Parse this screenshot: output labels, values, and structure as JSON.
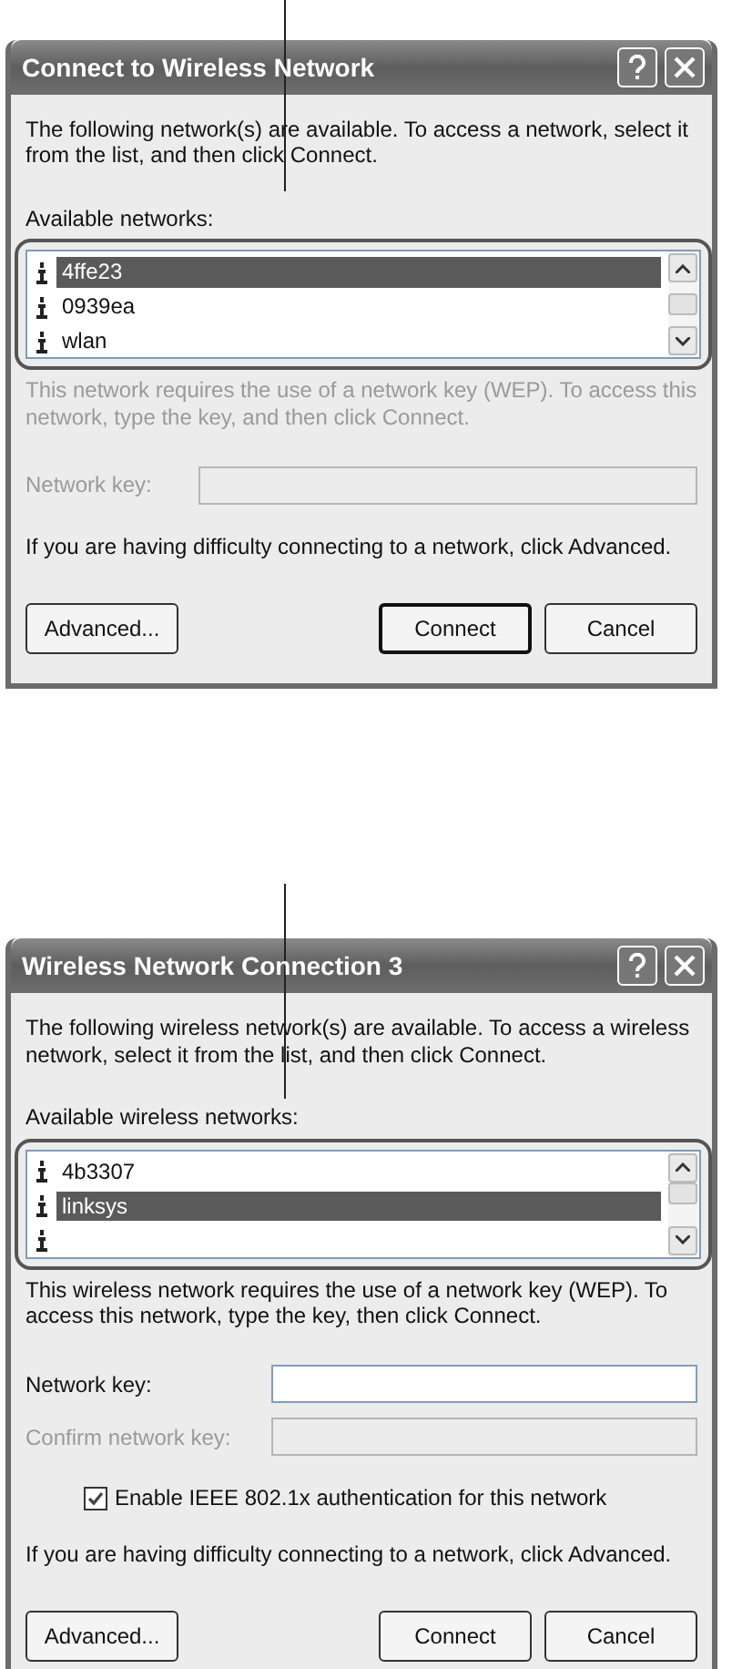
{
  "dialogs": [
    {
      "title": "Connect to Wireless Network",
      "intro": "The following network(s) are available. To access a network, select it from the list, and then click Connect.",
      "list_label": "Available networks:",
      "networks": [
        {
          "name": "4ffe23",
          "selected": true
        },
        {
          "name": "0939ea",
          "selected": false
        },
        {
          "name": "wlan",
          "selected": false
        }
      ],
      "key_note": {
        "text": "This network requires the use of a network key (WEP). To access this network, type the key, and then click Connect.",
        "disabled": true
      },
      "fields": [
        {
          "label": "Network key:",
          "disabled": true
        }
      ],
      "advice": "If you are having difficulty connecting to a network, click Advanced.",
      "buttons": [
        {
          "label": "Advanced...",
          "default": false
        },
        {
          "label": "Connect",
          "default": true
        },
        {
          "label": "Cancel",
          "default": false
        }
      ]
    },
    {
      "title": "Wireless Network Connection 3",
      "intro": "The following wireless network(s) are available. To access a wireless network, select it from the list, and then click Connect.",
      "list_label": "Available wireless networks:",
      "networks": [
        {
          "name": "4b3307",
          "selected": false
        },
        {
          "name": "linksys",
          "selected": true
        },
        {
          "selected": false
        }
      ],
      "key_note": {
        "text": "This wireless network requires the use of a network key (WEP). To access this network, type the key, then click Connect.",
        "disabled": false
      },
      "fields": [
        {
          "label": "Network key:",
          "disabled": false
        },
        {
          "label": "Confirm network key:",
          "disabled": true
        }
      ],
      "checkbox": {
        "label": "Enable IEEE 802.1x authentication for this network",
        "checked": true
      },
      "advice": "If you are having difficulty connecting to a network, click Advanced.",
      "buttons": [
        {
          "label": "Advanced...",
          "default": false
        },
        {
          "label": "Connect",
          "default": false
        },
        {
          "label": "Cancel",
          "default": false
        }
      ]
    }
  ]
}
